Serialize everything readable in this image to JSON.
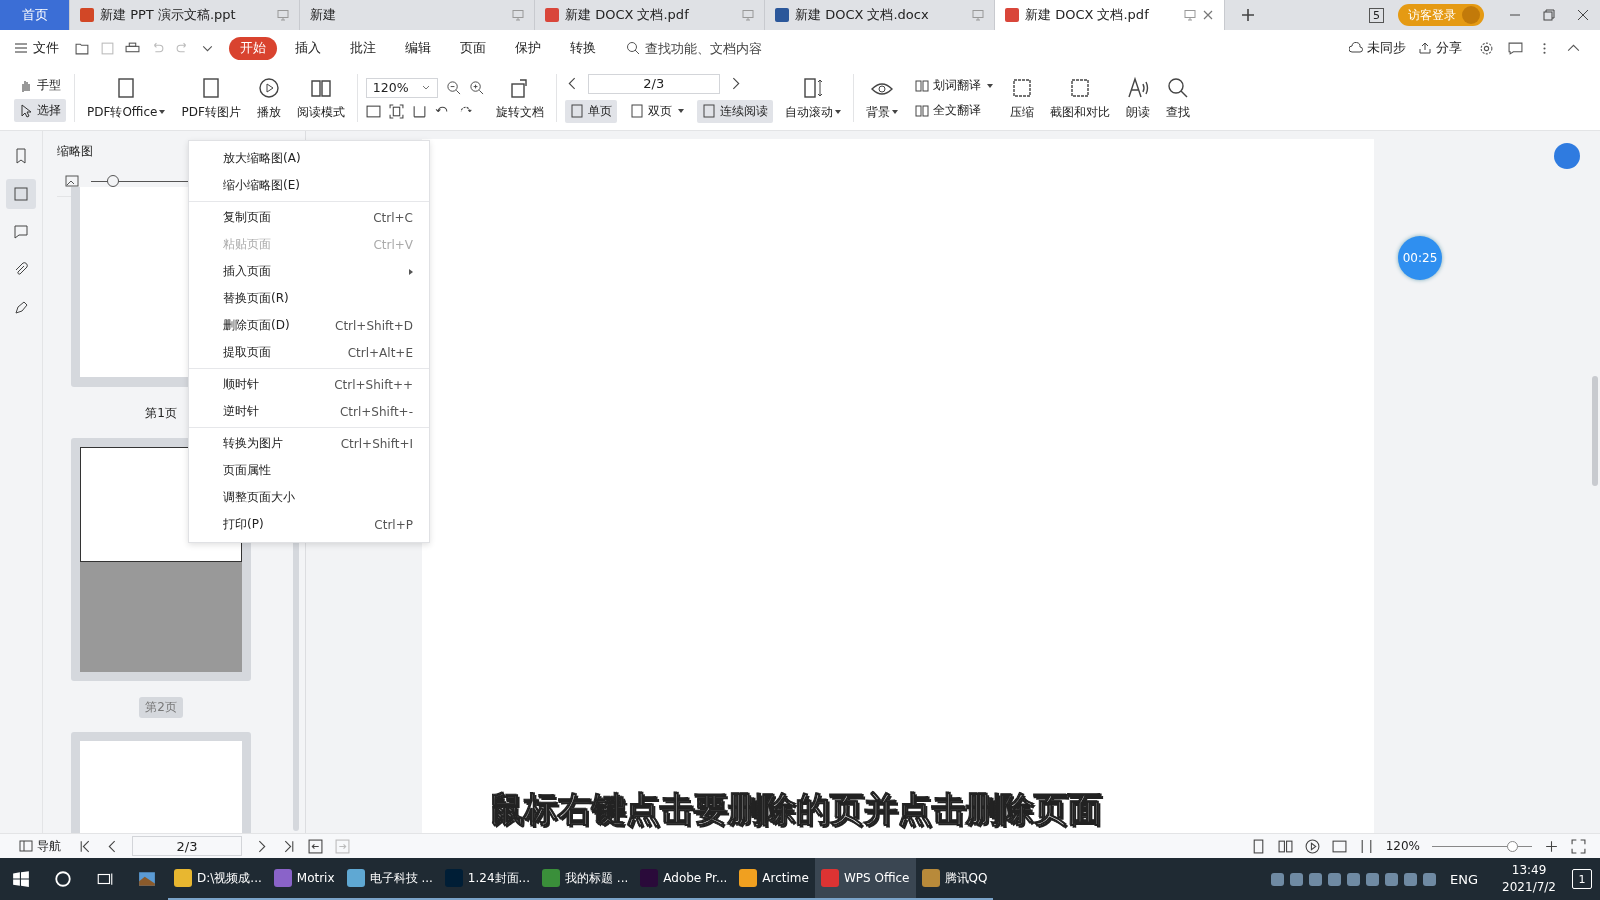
{
  "tabs": [
    {
      "label": "首页",
      "kind": "home",
      "selected": false
    },
    {
      "label": "新建 PPT 演示文稿.ppt",
      "kind": "ppt",
      "selected": false
    },
    {
      "label": "新建",
      "kind": "plain",
      "selected": false
    },
    {
      "label": "新建 DOCX 文档.pdf",
      "kind": "pdf",
      "selected": false
    },
    {
      "label": "新建 DOCX 文档.docx",
      "kind": "docx",
      "selected": false
    },
    {
      "label": "新建 DOCX 文档.pdf",
      "kind": "pdf",
      "selected": true
    }
  ],
  "window_badge": "5",
  "login": "访客登录",
  "menu_bar": {
    "file": "文件",
    "menus": [
      {
        "label": "开始",
        "selected": true
      },
      {
        "label": "插入",
        "selected": false
      },
      {
        "label": "批注",
        "selected": false
      },
      {
        "label": "编辑",
        "selected": false
      },
      {
        "label": "页面",
        "selected": false
      },
      {
        "label": "保护",
        "selected": false
      },
      {
        "label": "转换",
        "selected": false
      }
    ],
    "search": {
      "placeholder": "查找功能、文档内容"
    },
    "sync": "未同步",
    "share": "分享"
  },
  "toolbar": {
    "modes": [
      {
        "label": "手型",
        "selected": false
      },
      {
        "label": "选择",
        "selected": true
      }
    ],
    "tools_left": [
      {
        "label": "PDF转Office",
        "dropdown": true
      },
      {
        "label": "PDF转图片",
        "dropdown": false
      },
      {
        "label": "播放",
        "dropdown": false
      },
      {
        "label": "阅读模式",
        "dropdown": false
      }
    ],
    "zoom": "120%",
    "rotate": "旋转文档",
    "page": "2/3",
    "views": [
      {
        "label": "单页",
        "selected": true,
        "dropdown": false
      },
      {
        "label": "双页",
        "selected": false,
        "dropdown": true
      },
      {
        "label": "连续阅读",
        "selected": true,
        "dropdown": false
      }
    ],
    "auto_scroll": "自动滚动",
    "background": "背景",
    "translate": [
      "划词翻译",
      "全文翻译"
    ],
    "tools_right": [
      {
        "label": "压缩"
      },
      {
        "label": "截图和对比"
      },
      {
        "label": "朗读"
      },
      {
        "label": "查找"
      }
    ]
  },
  "side_rail": [
    {
      "selected": false
    },
    {
      "selected": true
    },
    {
      "selected": false
    },
    {
      "selected": false
    },
    {
      "selected": false
    }
  ],
  "thumbnails": {
    "title": "缩略图",
    "size": {
      "level": 0.2
    },
    "pages": [
      {
        "label": "第1页",
        "selected": false
      },
      {
        "label": "第2页",
        "selected": true
      },
      {
        "selected": false
      }
    ]
  },
  "context_menu": [
    [
      {
        "label": "放大缩略图(A)",
        "disabled": false
      },
      {
        "label": "缩小缩略图(E)",
        "disabled": false
      }
    ],
    [
      {
        "label": "复制页面",
        "shortcut": "Ctrl+C",
        "disabled": false
      },
      {
        "label": "粘贴页面",
        "shortcut": "Ctrl+V",
        "disabled": true
      },
      {
        "label": "插入页面",
        "submenu": true,
        "disabled": false
      },
      {
        "label": "替换页面(R)",
        "disabled": false
      },
      {
        "label": "删除页面(D)",
        "shortcut": "Ctrl+Shift+D",
        "disabled": false
      },
      {
        "label": "提取页面",
        "shortcut": "Ctrl+Alt+E",
        "disabled": false
      }
    ],
    [
      {
        "label": "顺时针",
        "shortcut": "Ctrl+Shift++",
        "disabled": false
      },
      {
        "label": "逆时针",
        "shortcut": "Ctrl+Shift+-",
        "disabled": false
      }
    ],
    [
      {
        "label": "转换为图片",
        "shortcut": "Ctrl+Shift+I",
        "disabled": false
      },
      {
        "label": "页面属性",
        "disabled": false
      },
      {
        "label": "调整页面大小",
        "disabled": false
      },
      {
        "label": "打印(P)",
        "shortcut": "Ctrl+P",
        "disabled": false
      }
    ]
  ],
  "timer": "00:25",
  "status_bar": {
    "nav": "导航",
    "page": "2/3",
    "zoom": "120%"
  },
  "caption": "鼠标右键点击要删除的页并点击删除页面",
  "taskbar": {
    "apps": [
      {
        "label": "D:\\视频成...",
        "selected": false
      },
      {
        "label": "Motrix",
        "selected": false
      },
      {
        "label": "电子科技 ...",
        "selected": false
      },
      {
        "label": "1.24封面...",
        "selected": false
      },
      {
        "label": "我的标题 ...",
        "selected": false
      },
      {
        "label": "Adobe Pr...",
        "selected": false
      },
      {
        "label": "Arctime",
        "selected": false
      },
      {
        "label": "WPS Office",
        "selected": true
      },
      {
        "label": "腾讯QQ",
        "selected": false
      }
    ],
    "lang": "ENG",
    "time": "13:49",
    "date": "2021/7/2",
    "notifications": "1"
  }
}
